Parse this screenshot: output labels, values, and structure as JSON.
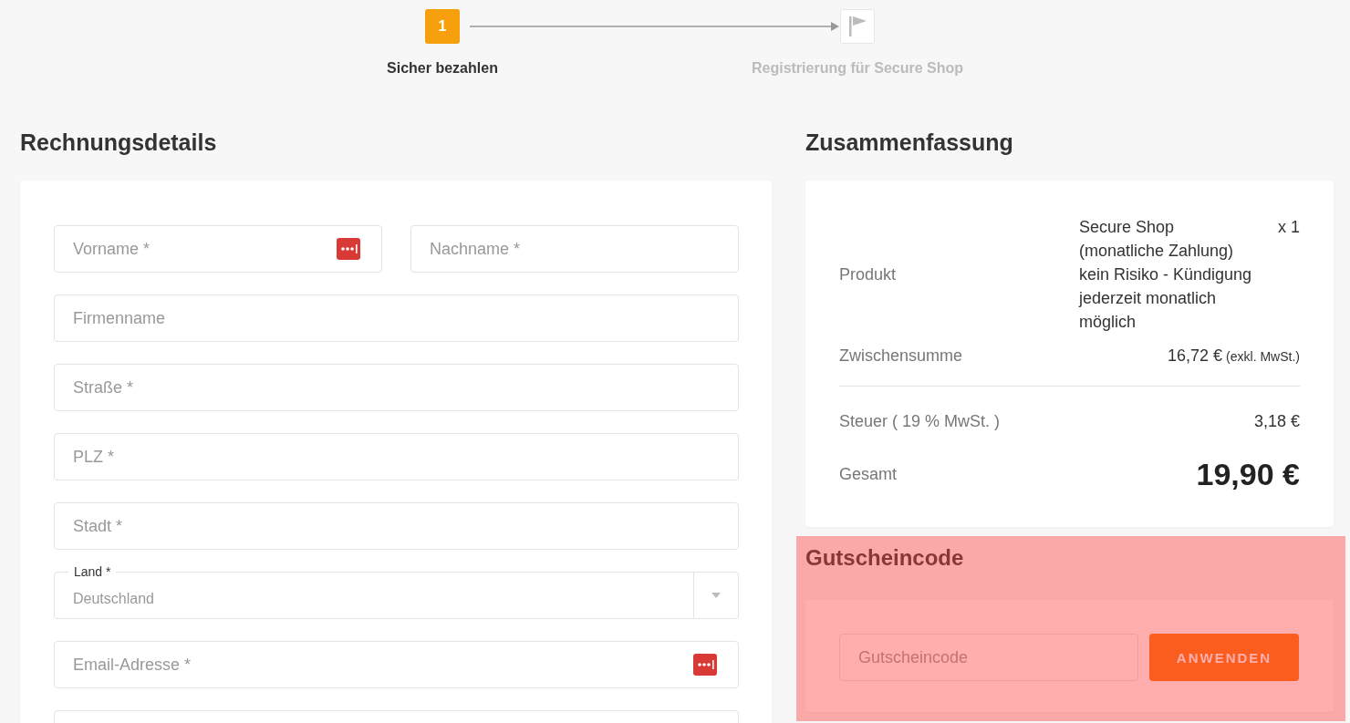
{
  "steps": [
    {
      "kind": "number",
      "number": "1",
      "label": "Sicher bezahlen",
      "selected": true
    },
    {
      "kind": "flag",
      "label": "Registrierung für Secure Shop",
      "selected": false
    }
  ],
  "billing": {
    "title": "Rechnungsdetails",
    "fields": [
      {
        "kind": "text",
        "placeholder": "Vorname *",
        "password_manager": true,
        "half": true
      },
      {
        "kind": "text",
        "placeholder": "Nachname *",
        "half": true
      },
      {
        "kind": "text",
        "placeholder": "Firmenname"
      },
      {
        "kind": "text",
        "placeholder": "Straße *"
      },
      {
        "kind": "text",
        "placeholder": "PLZ *"
      },
      {
        "kind": "text",
        "placeholder": "Stadt *"
      },
      {
        "kind": "select",
        "label": "Land *",
        "value": "Deutschland"
      },
      {
        "kind": "text",
        "placeholder": "Email-Adresse *",
        "password_manager": true
      },
      {
        "kind": "text"
      }
    ]
  },
  "summary": {
    "title": "Zusammenfassung",
    "rows": [
      {
        "kind": "product",
        "label": "Produkt",
        "lines": [
          "Secure Shop",
          "(monatliche Zahlung)",
          "kein Risiko - Kündigung",
          "jederzeit monatlich",
          "möglich"
        ],
        "quantity": "x 1"
      },
      {
        "kind": "amount",
        "label": "Zwischensumme",
        "value": "16,72 €",
        "note": "(exkl. MwSt.)",
        "divider_after": true
      },
      {
        "kind": "amount",
        "label": "Steuer ( 19 % MwSt. )",
        "value": "3,18 €"
      },
      {
        "kind": "total",
        "label": "Gesamt",
        "value": "19,90 €"
      }
    ]
  },
  "coupon": {
    "title": "Gutscheincode",
    "placeholder": "Gutscheincode",
    "button": "ANWENDEN",
    "highlighted": true
  }
}
